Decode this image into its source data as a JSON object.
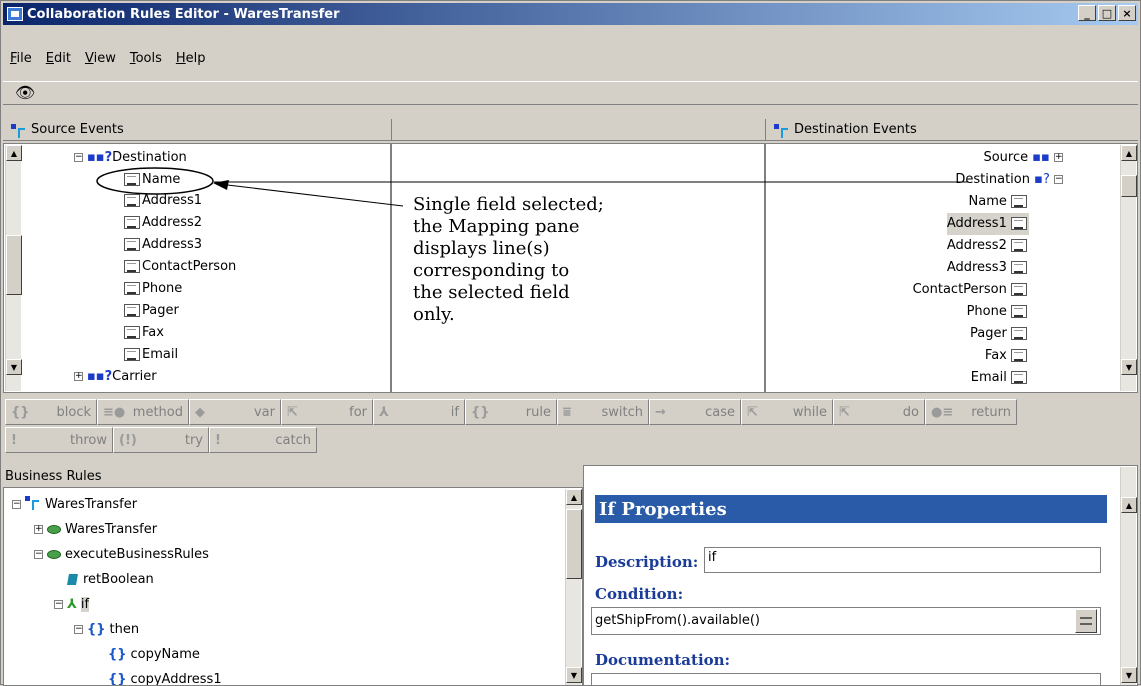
{
  "window": {
    "title": "Collaboration Rules Editor - WaresTransfer"
  },
  "title_buttons": {
    "minimize": "_",
    "maximize": "□",
    "close": "×"
  },
  "menu": [
    "File",
    "Edit",
    "View",
    "Tools",
    "Help"
  ],
  "source_pane": {
    "header": "Source Events",
    "items": [
      {
        "label": "Destination",
        "expander": "−"
      },
      {
        "label": "Name"
      },
      {
        "label": "Address1"
      },
      {
        "label": "Address2"
      },
      {
        "label": "Address3"
      },
      {
        "label": "ContactPerson"
      },
      {
        "label": "Phone"
      },
      {
        "label": "Pager"
      },
      {
        "label": "Fax"
      },
      {
        "label": "Email"
      },
      {
        "label": "Carrier",
        "expander": "+"
      }
    ]
  },
  "destination_pane": {
    "header": "Destination Events",
    "items": [
      {
        "label": "Source",
        "expander": "+"
      },
      {
        "label": "Destination",
        "expander": "−"
      },
      {
        "label": "Name"
      },
      {
        "label": "Address1"
      },
      {
        "label": "Address2"
      },
      {
        "label": "Address3"
      },
      {
        "label": "ContactPerson"
      },
      {
        "label": "Phone"
      },
      {
        "label": "Pager"
      },
      {
        "label": "Fax"
      },
      {
        "label": "Email"
      }
    ]
  },
  "annotation": [
    "Single field selected;",
    "the Mapping pane",
    "displays line(s)",
    "corresponding to",
    "the selected field",
    "only."
  ],
  "statement_toolbar": [
    {
      "glyph": "{}",
      "label": "block"
    },
    {
      "glyph": "≡●",
      "label": "method"
    },
    {
      "glyph": "◆",
      "label": "var"
    },
    {
      "glyph": "⇱",
      "label": "for"
    },
    {
      "glyph": "⅄",
      "label": "if"
    },
    {
      "glyph": "{}",
      "label": "rule"
    },
    {
      "glyph": "⩸",
      "label": "switch"
    },
    {
      "glyph": "→",
      "label": "case"
    },
    {
      "glyph": "⇱",
      "label": "while"
    },
    {
      "glyph": "⇱",
      "label": "do"
    },
    {
      "glyph": "●≡",
      "label": "return"
    },
    {
      "glyph": "!",
      "label": "throw"
    },
    {
      "glyph": "(!)",
      "label": "try"
    },
    {
      "glyph": "!",
      "label": "catch"
    }
  ],
  "business_rules": {
    "header": "Business Rules",
    "items": [
      {
        "label": "WaresTransfer",
        "expander": "−"
      },
      {
        "label": "WaresTransfer",
        "expander": "+"
      },
      {
        "label": "executeBusinessRules",
        "expander": "−"
      },
      {
        "label": "retBoolean"
      },
      {
        "label": "if",
        "expander": "−"
      },
      {
        "label": "then",
        "expander": "−"
      },
      {
        "label": "copyName"
      },
      {
        "label": "copyAddress1"
      }
    ]
  },
  "properties": {
    "title": "If Properties",
    "description_label": "Description:",
    "description_value": "if",
    "condition_label": "Condition:",
    "condition_value": "getShipFrom().available()",
    "documentation_label": "Documentation:"
  }
}
